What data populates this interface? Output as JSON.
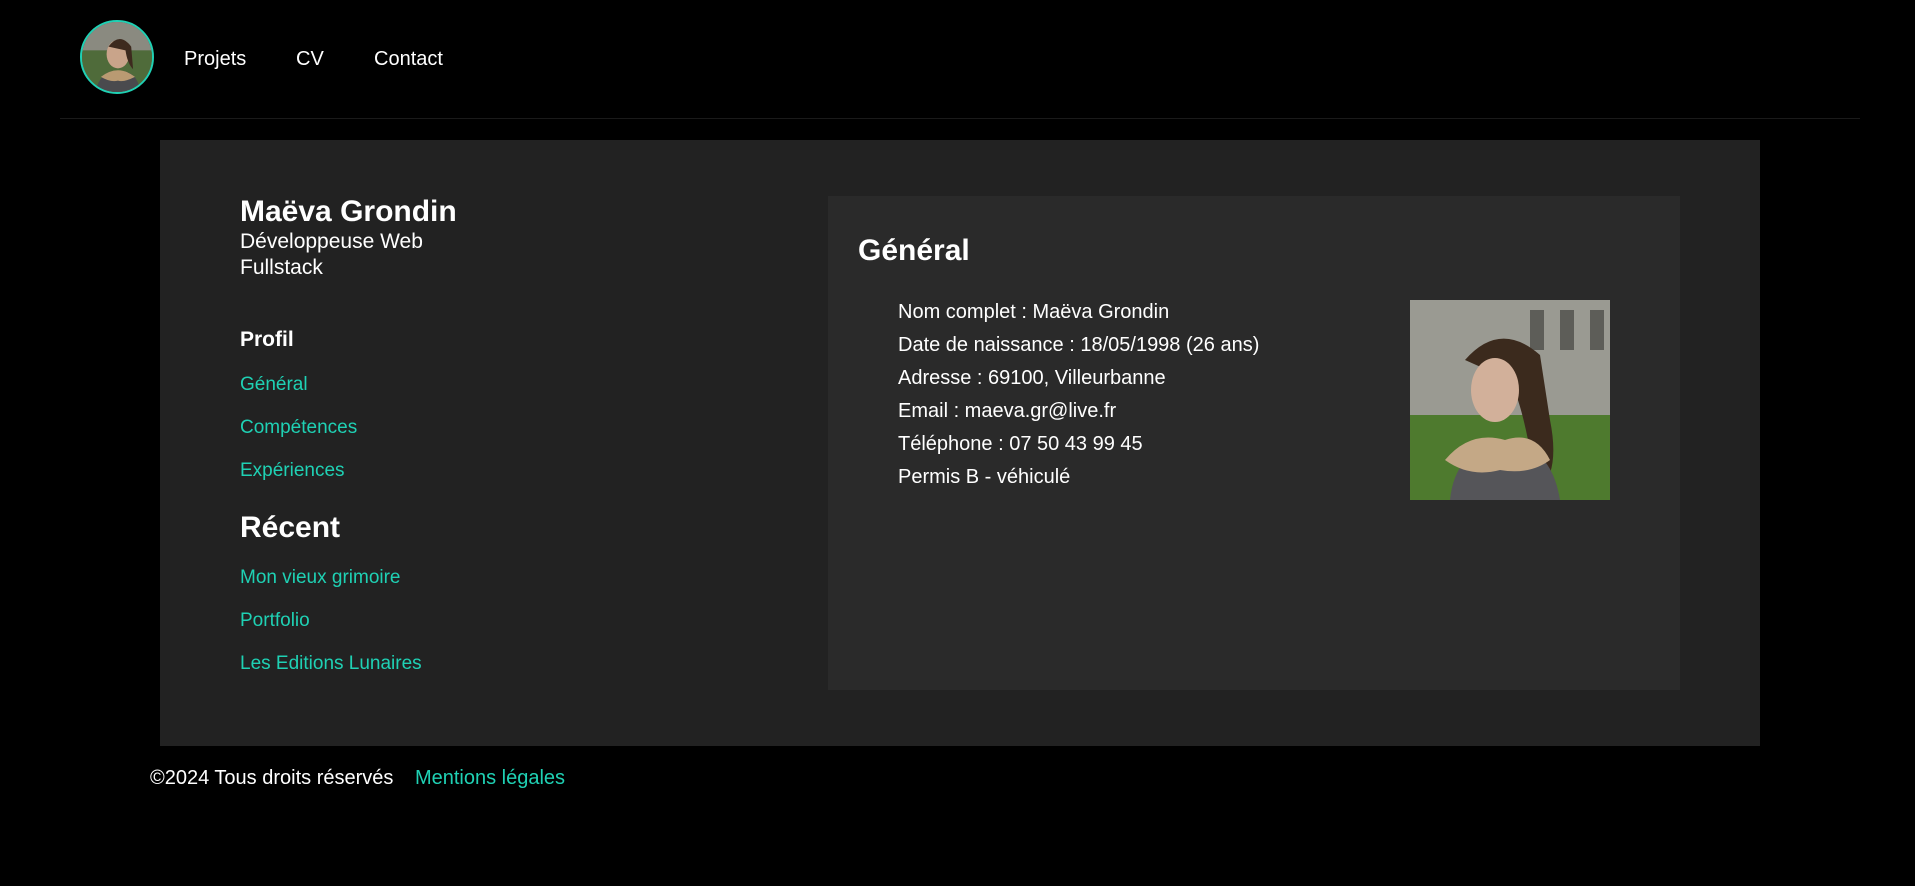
{
  "header": {
    "nav": [
      {
        "label": "Projets"
      },
      {
        "label": "CV"
      },
      {
        "label": "Contact"
      }
    ]
  },
  "sidebar": {
    "name": "Maëva Grondin",
    "role": "Développeuse Web Fullstack",
    "profil_heading": "Profil",
    "profil_links": [
      {
        "label": "Général"
      },
      {
        "label": "Compétences"
      },
      {
        "label": "Expériences"
      }
    ],
    "recent_heading": "Récent",
    "recent_links": [
      {
        "label": "Mon vieux grimoire"
      },
      {
        "label": "Portfolio"
      },
      {
        "label": "Les Editions Lunaires"
      }
    ]
  },
  "content": {
    "title": "Général",
    "info": [
      "Nom complet : Maëva Grondin",
      "Date de naissance : 18/05/1998 (26 ans)",
      "Adresse : 69100, Villeurbanne",
      "Email : maeva.gr@live.fr",
      "Téléphone : 07 50 43 99 45",
      "Permis B - véhiculé"
    ]
  },
  "footer": {
    "copyright": "©2024 Tous droits réservés",
    "legal_link": "Mentions légales"
  },
  "colors": {
    "accent": "#1fd1b4",
    "background": "#000000",
    "panel": "#222222",
    "card": "#2a2a2a"
  }
}
